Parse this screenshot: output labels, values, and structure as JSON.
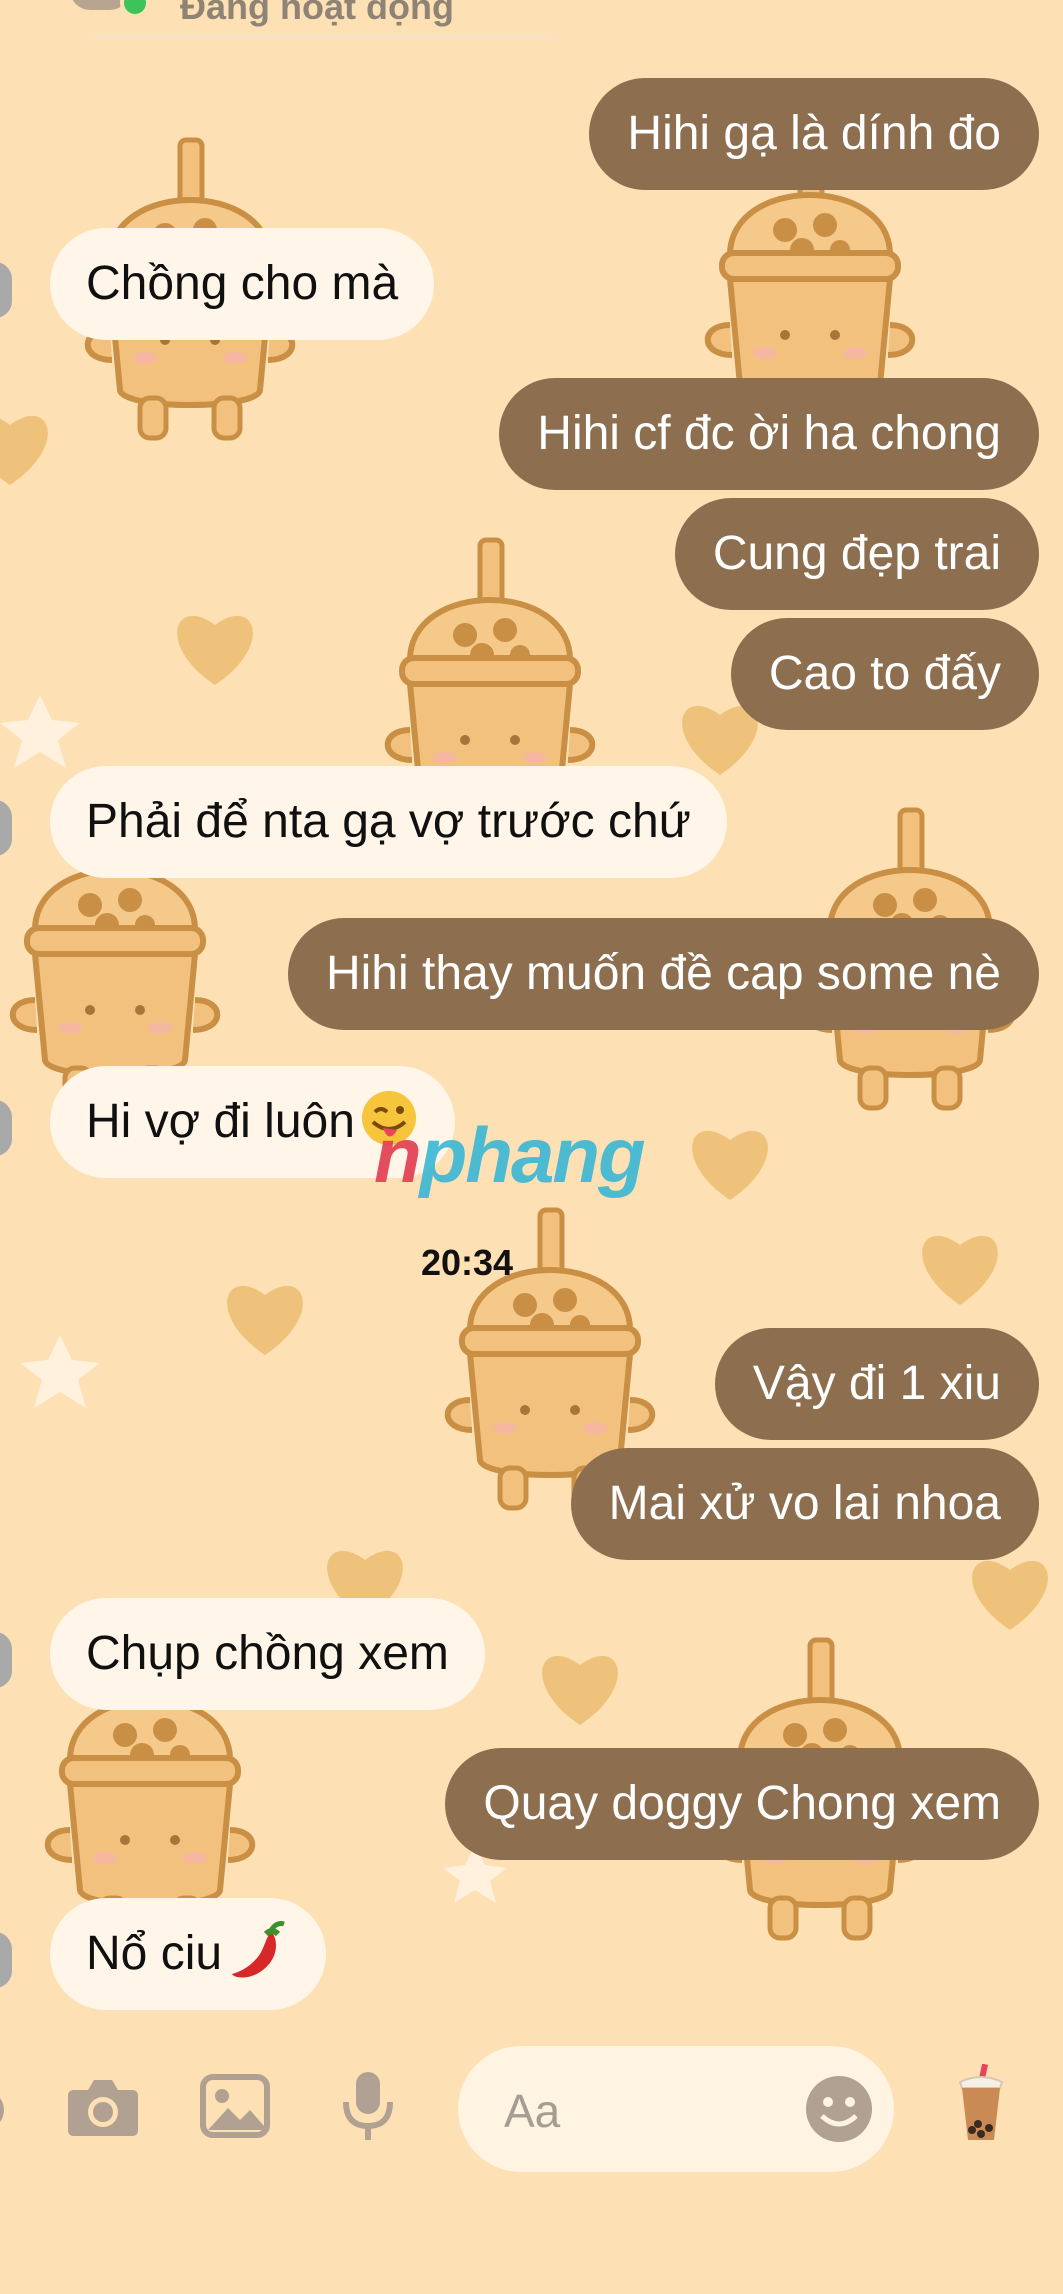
{
  "header": {
    "status_text": "Đang hoạt động"
  },
  "messages": [
    {
      "side": "out",
      "text": "Hihi gạ là dính đo"
    },
    {
      "side": "in",
      "text": "Chồng cho mà"
    },
    {
      "side": "out",
      "text": "Hihi cf đc ời ha chong"
    },
    {
      "side": "out",
      "text": "Cung đẹp trai"
    },
    {
      "side": "out",
      "text": "Cao to đấy"
    },
    {
      "side": "in",
      "text": "Phải để nta gạ vợ trước chứ"
    },
    {
      "side": "out",
      "text": "Hihi thay muốn đề cap some nè"
    },
    {
      "side": "in",
      "text": "Hi vợ đi luôn"
    },
    {
      "side": "out",
      "text": "Vậy đi 1 xiu"
    },
    {
      "side": "out",
      "text": "Mai xử vo lai nhoa"
    },
    {
      "side": "in",
      "text": "Chụp chồng xem"
    },
    {
      "side": "out",
      "text": "Quay doggy Chong xem"
    },
    {
      "side": "in",
      "text": "Nổ ciu"
    }
  ],
  "timestamp": "20:34",
  "watermark": {
    "first": "n",
    "rest": "phang"
  },
  "composer": {
    "placeholder": "Aa",
    "icons": [
      "camera-icon",
      "image-icon",
      "microphone-icon",
      "smile-emoji-icon",
      "bubble-tea-icon"
    ]
  },
  "colors": {
    "background": "#fde0b4",
    "outgoing_bubble": "#8d6e4f",
    "incoming_bubble": "#fff6e9",
    "icon_brown": "#b0a193"
  }
}
